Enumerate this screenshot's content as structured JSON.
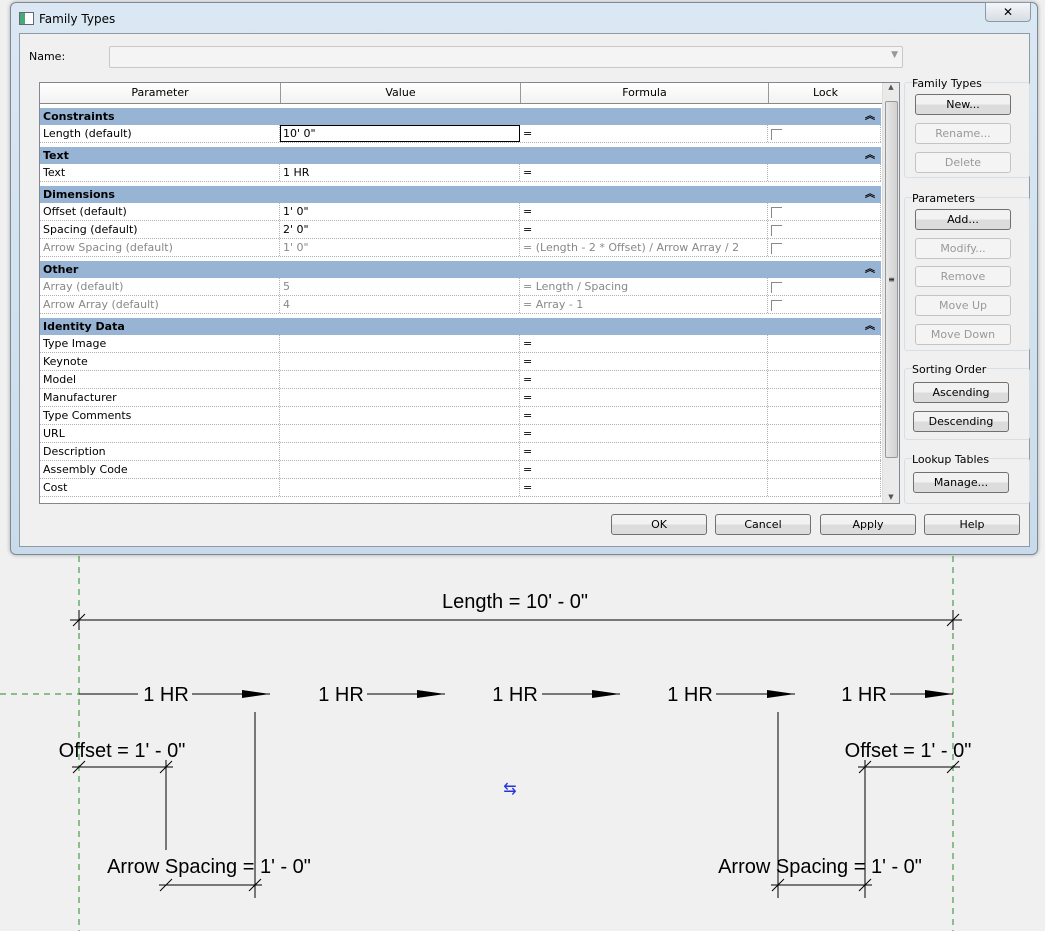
{
  "window": {
    "title": "Family Types",
    "close": "✕"
  },
  "name_label": "Name:",
  "columns": [
    "Parameter",
    "Value",
    "Formula",
    "Lock"
  ],
  "groups": [
    {
      "label": "Constraints",
      "rows": [
        {
          "param": "Length (default)",
          "value": "10'  0\"",
          "formula": "=",
          "lock": true,
          "dim": false
        }
      ]
    },
    {
      "label": "Text",
      "rows": [
        {
          "param": "Text",
          "value": "1 HR",
          "formula": "=",
          "lock": false,
          "dim": false
        }
      ]
    },
    {
      "label": "Dimensions",
      "rows": [
        {
          "param": "Offset (default)",
          "value": "1'  0\"",
          "formula": "=",
          "lock": true,
          "dim": false
        },
        {
          "param": "Spacing (default)",
          "value": "2'  0\"",
          "formula": "=",
          "lock": true,
          "dim": false
        },
        {
          "param": "Arrow Spacing (default)",
          "value": "1'  0\"",
          "formula": "= (Length - 2 * Offset) / Arrow Array / 2",
          "lock": true,
          "dim": true
        }
      ]
    },
    {
      "label": "Other",
      "rows": [
        {
          "param": "Array (default)",
          "value": "5",
          "formula": "= Length / Spacing",
          "lock": true,
          "dim": true
        },
        {
          "param": "Arrow Array (default)",
          "value": "4",
          "formula": "= Array - 1",
          "lock": true,
          "dim": true
        }
      ]
    },
    {
      "label": "Identity Data",
      "rows": [
        {
          "param": "Type Image",
          "value": "",
          "formula": "=",
          "lock": false
        },
        {
          "param": "Keynote",
          "value": "",
          "formula": "=",
          "lock": false
        },
        {
          "param": "Model",
          "value": "",
          "formula": "=",
          "lock": false
        },
        {
          "param": "Manufacturer",
          "value": "",
          "formula": "=",
          "lock": false
        },
        {
          "param": "Type Comments",
          "value": "",
          "formula": "=",
          "lock": false
        },
        {
          "param": "URL",
          "value": "",
          "formula": "=",
          "lock": false
        },
        {
          "param": "Description",
          "value": "",
          "formula": "=",
          "lock": false
        },
        {
          "param": "Assembly Code",
          "value": "",
          "formula": "=",
          "lock": false
        },
        {
          "param": "Cost",
          "value": "",
          "formula": "=",
          "lock": false
        }
      ]
    }
  ],
  "side": {
    "family_types": {
      "label": "Family Types",
      "new": "New...",
      "rename": "Rename...",
      "delete": "Delete"
    },
    "parameters": {
      "label": "Parameters",
      "add": "Add...",
      "modify": "Modify...",
      "remove": "Remove",
      "move_up": "Move Up",
      "move_down": "Move Down"
    },
    "sorting": {
      "label": "Sorting Order",
      "asc": "Ascending",
      "desc": "Descending"
    },
    "lookup": {
      "label": "Lookup Tables",
      "manage": "Manage..."
    }
  },
  "footer": {
    "ok": "OK",
    "cancel": "Cancel",
    "apply": "Apply",
    "help": "Help"
  },
  "drawing": {
    "length": "Length = 10' - 0\"",
    "tag": "1 HR",
    "offset": "Offset = 1' - 0\"",
    "arrow_spacing": "Arrow Spacing = 1' - 0\"",
    "flip": "⇆"
  }
}
